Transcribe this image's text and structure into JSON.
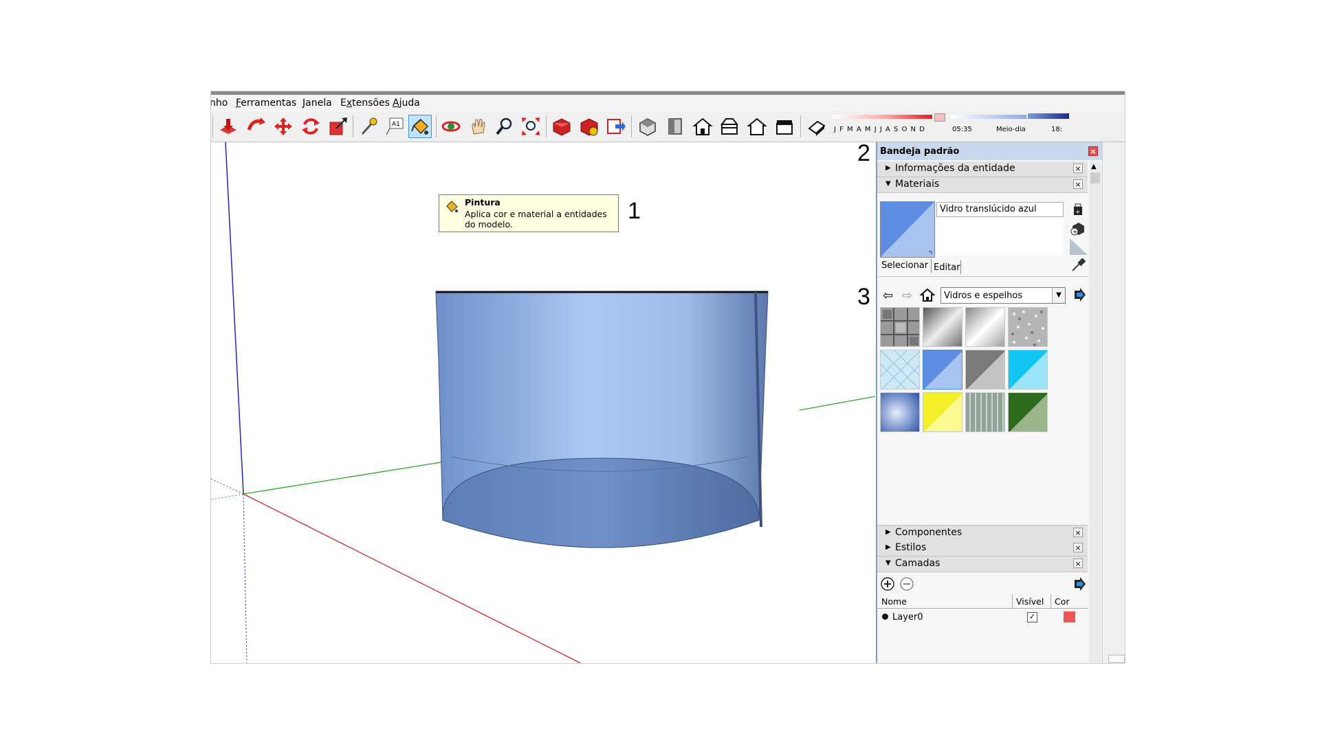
{
  "menu": {
    "items": [
      {
        "label": "nho",
        "underline": ""
      },
      {
        "label": "Ferramentas",
        "underline": "F"
      },
      {
        "label": "Janela",
        "underline": "J"
      },
      {
        "label": "Extensões",
        "underline": "x"
      },
      {
        "label": "Ajuda",
        "underline": "A"
      }
    ]
  },
  "toolbar": {
    "months": "J F M A M J J A S O N D",
    "time_start": "05:35",
    "time_mid": "Meio-dia",
    "time_end": "18:",
    "active_tool": "paint-bucket-icon",
    "icons": [
      "push-pull-icon",
      "follow-me-icon",
      "move-icon",
      "rotate-icon",
      "scale-icon",
      "tape-measure-icon",
      "text-label-icon",
      "paint-bucket-icon",
      "orbit-icon",
      "pan-icon",
      "zoom-icon",
      "zoom-extents-icon",
      "warehouse-icon",
      "extension-warehouse-icon",
      "send-to-layout-icon",
      "iso-view-icon",
      "top-view-icon",
      "front-view-icon",
      "right-view-icon",
      "back-view-icon",
      "left-view-icon",
      "eraser-icon"
    ]
  },
  "tooltip": {
    "title": "Pintura",
    "description": "Aplica cor e material a entidades do modelo."
  },
  "callouts": {
    "one": "1",
    "two": "2",
    "three": "3"
  },
  "tray": {
    "title": "Bandeja padrão",
    "sections": {
      "entity_info": "Informações da entidade",
      "materials": "Materiais",
      "components": "Componentes",
      "styles": "Estilos",
      "layers": "Camadas"
    },
    "material": {
      "name": "Vidro translúcido azul",
      "tab_select": "Selecionar",
      "tab_edit": "Editar",
      "library": "Vidros e espelhos",
      "color": "#5d8de0"
    },
    "layers": {
      "col_name": "Nome",
      "col_visible": "Visível",
      "col_color": "Cor",
      "row_name": "Layer0",
      "row_visible": true,
      "row_color": "#f05555"
    }
  },
  "colors": {
    "accent": "#3f8fd8",
    "cylinder": "#8fb3e6",
    "axis_red": "#cc0000",
    "axis_green": "#00aa00",
    "axis_blue": "#0000cc"
  }
}
